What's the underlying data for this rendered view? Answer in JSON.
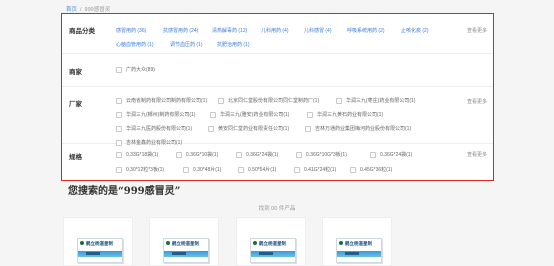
{
  "breadcrumb": {
    "home": "首页",
    "separator": "/",
    "current": "999感冒灵"
  },
  "filters": {
    "category": {
      "label": "商品分类",
      "more": "查看更多",
      "row1": [
        "感冒用药 (36)",
        "抗感冒用药 (24)",
        "清热解毒药 (12)",
        "儿科用药 (4)",
        "儿科感冒 (4)",
        "呼吸系统用药 (2)",
        "止咳化痰 (2)"
      ],
      "row2": [
        "心脑血管用药 (1)",
        "调节血压药 (1)",
        "抗肥治用药 (1)"
      ]
    },
    "merchant": {
      "label": "商家",
      "options": [
        "广药大众(89)"
      ]
    },
    "manufacturer": {
      "label": "厂家",
      "more": "查看更多",
      "options": [
        "云南省制药有限公司制药有限公司(1)",
        "北京同仁堂股份有限公司同仁堂制药厂(1)",
        "华润三九(枣庄)药业有限公司(1)",
        "华润三九(郴州)制药有限公司(1)",
        "华润三九(雅安)药业有限公司(1)",
        "华润三九黄石药业有限公司(1)",
        "华润三九医药股份有限公司(1)",
        "黄安同仁堂药业有限责任公司(1)",
        "吉林万通药业集团梅河药业股份有限公司(1)",
        "吉林金鑫药业有限公司(1)"
      ]
    },
    "spec": {
      "label": "规格",
      "more": "查看更多",
      "options": [
        "0.33G*18袋(1)",
        "0.36G*10袋(1)",
        "0.36G*24袋(1)",
        "0.36G*10G*3板(1)",
        "0.36G*24袋(1)",
        "0.30*12粒*3板(1)",
        "0.30*48片(1)",
        "0.50*54片(1)",
        "0.41G*24粒(1)",
        "0.45G*36粒(1)"
      ]
    }
  },
  "search": {
    "title": "您搜索的是“999感冒灵”",
    "count": "找到 00 件产品"
  },
  "products": [
    {
      "brand": "鹤立杨道星制"
    },
    {
      "brand": "鹤立杨道星制"
    },
    {
      "brand": "鹤立杨道星制"
    },
    {
      "brand": "鹤立杨道星制"
    }
  ],
  "colors": {
    "accent": "#d9231c",
    "link": "#3a7bd5",
    "box_stripe": "#3a9bd9"
  }
}
